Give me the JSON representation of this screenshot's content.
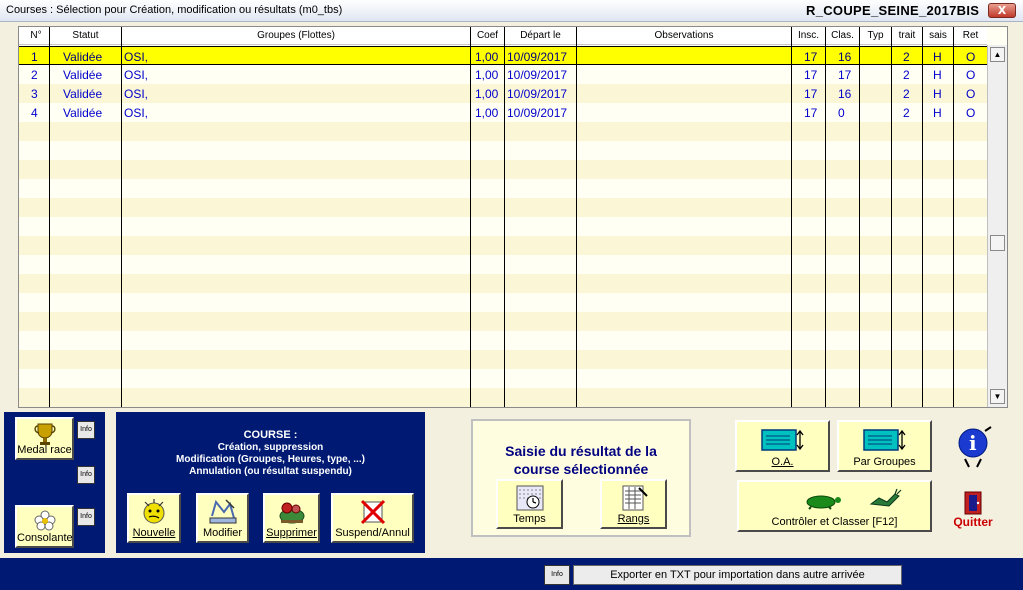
{
  "window": {
    "title": "Courses : Sélection pour Création, modification ou résultats    (m0_tbs)",
    "right_title": "R_COUPE_SEINE_2017BIS",
    "close_label": "X"
  },
  "grid": {
    "columns": [
      "N°",
      "Statut",
      "Groupes (Flottes)",
      "Coef",
      "Départ le",
      "Observations",
      "Insc.",
      "Clas.",
      "Typ",
      "trait",
      "sais",
      "Ret"
    ],
    "rows": [
      {
        "n": "1",
        "statut": "Validée",
        "groupes": "OSI,",
        "coef": "1,00",
        "depart": "10/09/2017",
        "obs": "",
        "insc": "17",
        "clas": "16",
        "typ": "",
        "trait": "2",
        "sais": "H",
        "ret": "O"
      },
      {
        "n": "2",
        "statut": "Validée",
        "groupes": "OSI,",
        "coef": "1,00",
        "depart": "10/09/2017",
        "obs": "",
        "insc": "17",
        "clas": "17",
        "typ": "",
        "trait": "2",
        "sais": "H",
        "ret": "O"
      },
      {
        "n": "3",
        "statut": "Validée",
        "groupes": "OSI,",
        "coef": "1,00",
        "depart": "10/09/2017",
        "obs": "",
        "insc": "17",
        "clas": "16",
        "typ": "",
        "trait": "2",
        "sais": "H",
        "ret": "O"
      },
      {
        "n": "4",
        "statut": "Validée",
        "groupes": "OSI,",
        "coef": "1,00",
        "depart": "10/09/2017",
        "obs": "",
        "insc": "17",
        "clas": "0",
        "typ": "",
        "trait": "2",
        "sais": "H",
        "ret": "O"
      }
    ]
  },
  "left_panel": {
    "medal_label": "Medal race",
    "consolante_label": "Consolante",
    "info_label": "Info"
  },
  "course_panel": {
    "heading": "COURSE :",
    "lines": [
      "Création, suppression",
      "Modification (Groupes, Heures, type, ...)",
      "Annulation (ou résultat suspendu)"
    ],
    "buttons": {
      "nouvelle": "Nouvelle",
      "modifier": "Modifier",
      "supprimer": "Supprimer",
      "suspend": "Suspend/Annul"
    }
  },
  "saisie": {
    "title_line1": "Saisie du résultat de la",
    "title_line2": "course sélectionnée",
    "temps": "Temps",
    "rangs": "Rangs"
  },
  "actions": {
    "oa": "O.A.",
    "par_groupes": "Par Groupes",
    "controler": "Contrôler et Classer [F12]",
    "quitter": "Quitter"
  },
  "footer": {
    "info_label": "Info",
    "export_label": "Exporter  en TXT pour importation dans  autre arrivée"
  }
}
